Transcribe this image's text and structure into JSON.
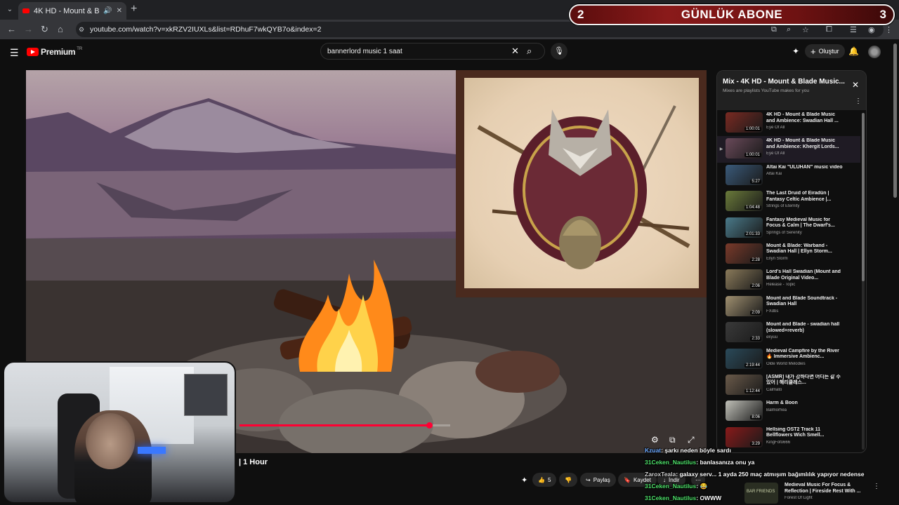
{
  "browser": {
    "tab_title": "4K HD - Mount & Blade Mu",
    "url": "youtube.com/watch?v=xkRZV2IUXLs&list=RDhuF7wkQYB7o&index=2"
  },
  "overlay": {
    "left_count": "2",
    "label": "GÜNLÜK ABONE",
    "right_count": "3"
  },
  "header": {
    "logo_text": "Premium",
    "logo_region": "TR",
    "search_value": "bannerlord music 1 saat",
    "create_label": "Oluştur"
  },
  "video": {
    "title": "| 1 Hour",
    "progress": 0.9
  },
  "actions": {
    "likes": "5",
    "share": "Paylaş",
    "save": "Kaydet",
    "download": "İndir"
  },
  "playlist": {
    "title": "Mix - 4K HD - Mount & Blade Music...",
    "subtitle": "Mixes are playlists YouTube makes for you",
    "items": [
      {
        "title": "4K HD - Mount & Blade Music and Ambience: Swadian Hall ...",
        "channel": "Eye Of All",
        "duration": "1:00:01",
        "color": "#7a2a22"
      },
      {
        "title": "4K HD - Mount & Blade Music and Ambience: Khergit Lords...",
        "channel": "Eye Of All",
        "duration": "1:00:01",
        "color": "#6a4a5a"
      },
      {
        "title": "Altai Kai \"ULUHAN\" music video",
        "channel": "Altai Kai",
        "duration": "5:27",
        "color": "#3a5a7a"
      },
      {
        "title": "The Last Druid of Eiradûn | Fantasy Celtic Ambience |...",
        "channel": "Strings of Eternity",
        "duration": "1:04:48",
        "color": "#6a7a3a"
      },
      {
        "title": "Fantasy Medieval Music for Focus & Calm | The Dwarf's...",
        "channel": "Springs of Serenity",
        "duration": "2:01:33",
        "color": "#4a7a8a"
      },
      {
        "title": "Mount & Blade: Warband - Swadian Hall | Ellyn Storm...",
        "channel": "Ellyn Storm",
        "duration": "2:28",
        "color": "#7a3a2a"
      },
      {
        "title": "Lord's Hall Swadian (Mount and Blade Original Video...",
        "channel": "Release - Topic",
        "duration": "2:06",
        "color": "#8a7a5a"
      },
      {
        "title": "Mount and Blade Soundtrack - Swadian Hall",
        "channel": "FXdbs",
        "duration": "2:09",
        "color": "#a09070"
      },
      {
        "title": "Mount and Blade - swadian hall (slowed+reverb)",
        "channel": "ekyuu",
        "duration": "2:33",
        "color": "#3a3a3a"
      },
      {
        "title": "Medieval Campfire by the River 🔥 Immersive Ambienc...",
        "channel": "Olde World Melodies",
        "duration": "2:19:44",
        "color": "#2a4a5a"
      },
      {
        "title": "[ASMR] 내가 강하다면 어디든 갈 수 있어 | 해리클레스...",
        "channel": "Calmato",
        "duration": "1:12:44",
        "color": "#6a5a4a"
      },
      {
        "title": "Harm & Boon",
        "channel": "Balmorhea",
        "duration": "8:06",
        "color": "#c0c0b8"
      },
      {
        "title": "Hellsing OST2 Track 11 Bellflowers Wich Smell...",
        "channel": "KingFofo666",
        "duration": "3:29",
        "color": "#8a1a1a"
      }
    ]
  },
  "recommendation": {
    "title": "Medieval Music For Focus & Reflection | Fireside Rest With ...",
    "channel": "Forest Of Light",
    "thumb_text": "BAR FRIENDS"
  },
  "chat": [
    {
      "name": "Kzuat",
      "text": "şarkı neden böyle sardı",
      "style": "blue"
    },
    {
      "name": "31Ceken_Nautilus",
      "text": "banlasanıza onu ya",
      "style": "green"
    },
    {
      "name": "ZaroxTeala",
      "text": "galaxy serv... 1 ayda 250 maç atmışım bağımlılık yapıyor nedense",
      "style": "gray"
    },
    {
      "name": "31Ceken_Nautilus",
      "text": "😂",
      "style": "green"
    },
    {
      "name": "31Ceken_Nautilus",
      "text": "OWWW",
      "style": "green"
    }
  ]
}
